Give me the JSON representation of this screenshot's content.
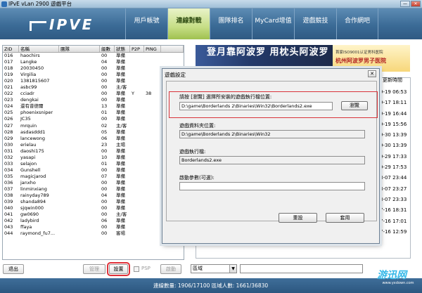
{
  "window": {
    "title": "IPvE vLan 2900 遊戲平台",
    "min_label": "—",
    "close_label": "✕"
  },
  "header": {
    "logo": "IPVE",
    "tabs": [
      "用戶帳號",
      "連線對戰",
      "團隊排名",
      "MyCard增值",
      "遊戲競技",
      "合作網吧"
    ],
    "active_tab": "連線對戰"
  },
  "player_table": {
    "columns": [
      "ZID",
      "名稱",
      "團隊",
      "級數",
      "狀態",
      "P2P",
      "PING"
    ],
    "rows": [
      [
        "016",
        "haochirs",
        "",
        "00",
        "準備",
        "",
        ""
      ],
      [
        "017",
        "Langke",
        "",
        "04",
        "準備",
        "",
        ""
      ],
      [
        "018",
        "20030450",
        "",
        "00",
        "準備",
        "",
        ""
      ],
      [
        "019",
        "Virgilia",
        "",
        "00",
        "準備",
        "",
        ""
      ],
      [
        "020",
        "1381815607",
        "",
        "00",
        "準備",
        "",
        ""
      ],
      [
        "021",
        "asbc99",
        "",
        "00",
        "主/客",
        "",
        ""
      ],
      [
        "022",
        "cciadr",
        "",
        "00",
        "準備",
        "Y",
        "38"
      ],
      [
        "023",
        "dengkai",
        "",
        "00",
        "準備",
        "",
        ""
      ],
      [
        "024",
        "還有昔德爾",
        "",
        "13",
        "準備",
        "",
        ""
      ],
      [
        "025",
        "phoenixsniper",
        "",
        "01",
        "準備",
        "",
        ""
      ],
      [
        "026",
        "JC35",
        "",
        "00",
        "準備",
        "",
        ""
      ],
      [
        "027",
        "mrquin",
        "",
        "02",
        "主/客",
        "",
        ""
      ],
      [
        "028",
        "asdasddd1",
        "",
        "05",
        "準備",
        "",
        ""
      ],
      [
        "029",
        "lancewong",
        "",
        "06",
        "準備",
        "",
        ""
      ],
      [
        "030",
        "erielau",
        "",
        "23",
        "主場",
        "",
        ""
      ],
      [
        "031",
        "daoshi175",
        "",
        "00",
        "準備",
        "",
        ""
      ],
      [
        "032",
        "yasapi",
        "",
        "10",
        "準備",
        "",
        ""
      ],
      [
        "033",
        "selajon",
        "",
        "01",
        "準備",
        "",
        ""
      ],
      [
        "034",
        "Gunshell",
        "",
        "00",
        "準備",
        "",
        ""
      ],
      [
        "035",
        "magicjarod",
        "",
        "07",
        "準備",
        "",
        ""
      ],
      [
        "036",
        "janxho",
        "",
        "00",
        "準備",
        "",
        ""
      ],
      [
        "037",
        "linminxiang",
        "",
        "00",
        "準備",
        "",
        ""
      ],
      [
        "038",
        "rainyday789",
        "",
        "04",
        "準備",
        "",
        ""
      ],
      [
        "039",
        "shanda894",
        "",
        "00",
        "準備",
        "",
        ""
      ],
      [
        "040",
        "sjqwin000",
        "",
        "00",
        "準備",
        "",
        ""
      ],
      [
        "041",
        "gw0690",
        "",
        "00",
        "主/客",
        "",
        ""
      ],
      [
        "042",
        "ladybird",
        "",
        "06",
        "準備",
        "",
        ""
      ],
      [
        "043",
        "ffaya",
        "",
        "00",
        "準備",
        "",
        ""
      ],
      [
        "044",
        "raymond_fu7...",
        "",
        "00",
        "客場",
        "",
        ""
      ]
    ]
  },
  "left_buttons": {
    "exit": "退出",
    "manage": "管理",
    "settings": "設置",
    "psp": "PSP",
    "launch": "啟動"
  },
  "banner": {
    "text": "登月靠阿波罗 用枕头阿波罗",
    "ad_line1": "首家ISO9001认证男科医院",
    "ad_line2": "杭州阿波罗男子医院"
  },
  "news": {
    "header": "更新時間",
    "times": [
      "9-19 06:53",
      "9-17 18:11",
      "9-19 16:44",
      "9-19 15:56",
      "9-30 13:39",
      "9-30 13:39",
      "9-29 17:33",
      "9-29 17:53",
      "8-07 23:44",
      "8-07 23:27",
      "8-07 23:33",
      "7-16 18:31",
      "7-16 17:01",
      "7-16 12:59"
    ]
  },
  "chat": {
    "region": "區域",
    "dropdown_arrow": "▼"
  },
  "status": {
    "text": "連線數量: 1906/17100   區域人數: 1661/36830"
  },
  "watermark": {
    "line1": "游迅网",
    "line2": "www.yxdown.com"
  },
  "dialog": {
    "title": "遊戲設定",
    "close": "✕",
    "exe_label": "請按 [瀏覽] 選擇所安裝的遊戲執行檔位置:",
    "exe_value": "D:\\game\\Borderlands 2\\Binaries\\Win32\\Borderlands2.exe",
    "browse": "瀏覽",
    "data_label": "遊戲資料夾位置:",
    "data_value": "D:\\game\\Borderlands 2\\Binaries\\Win32",
    "exe_file_label": "遊戲執行檔:",
    "exe_file_value": "Borderlands2.exe",
    "params_label": "啟動參數(可選):",
    "params_value": "",
    "reset": "重設",
    "apply": "套用"
  }
}
